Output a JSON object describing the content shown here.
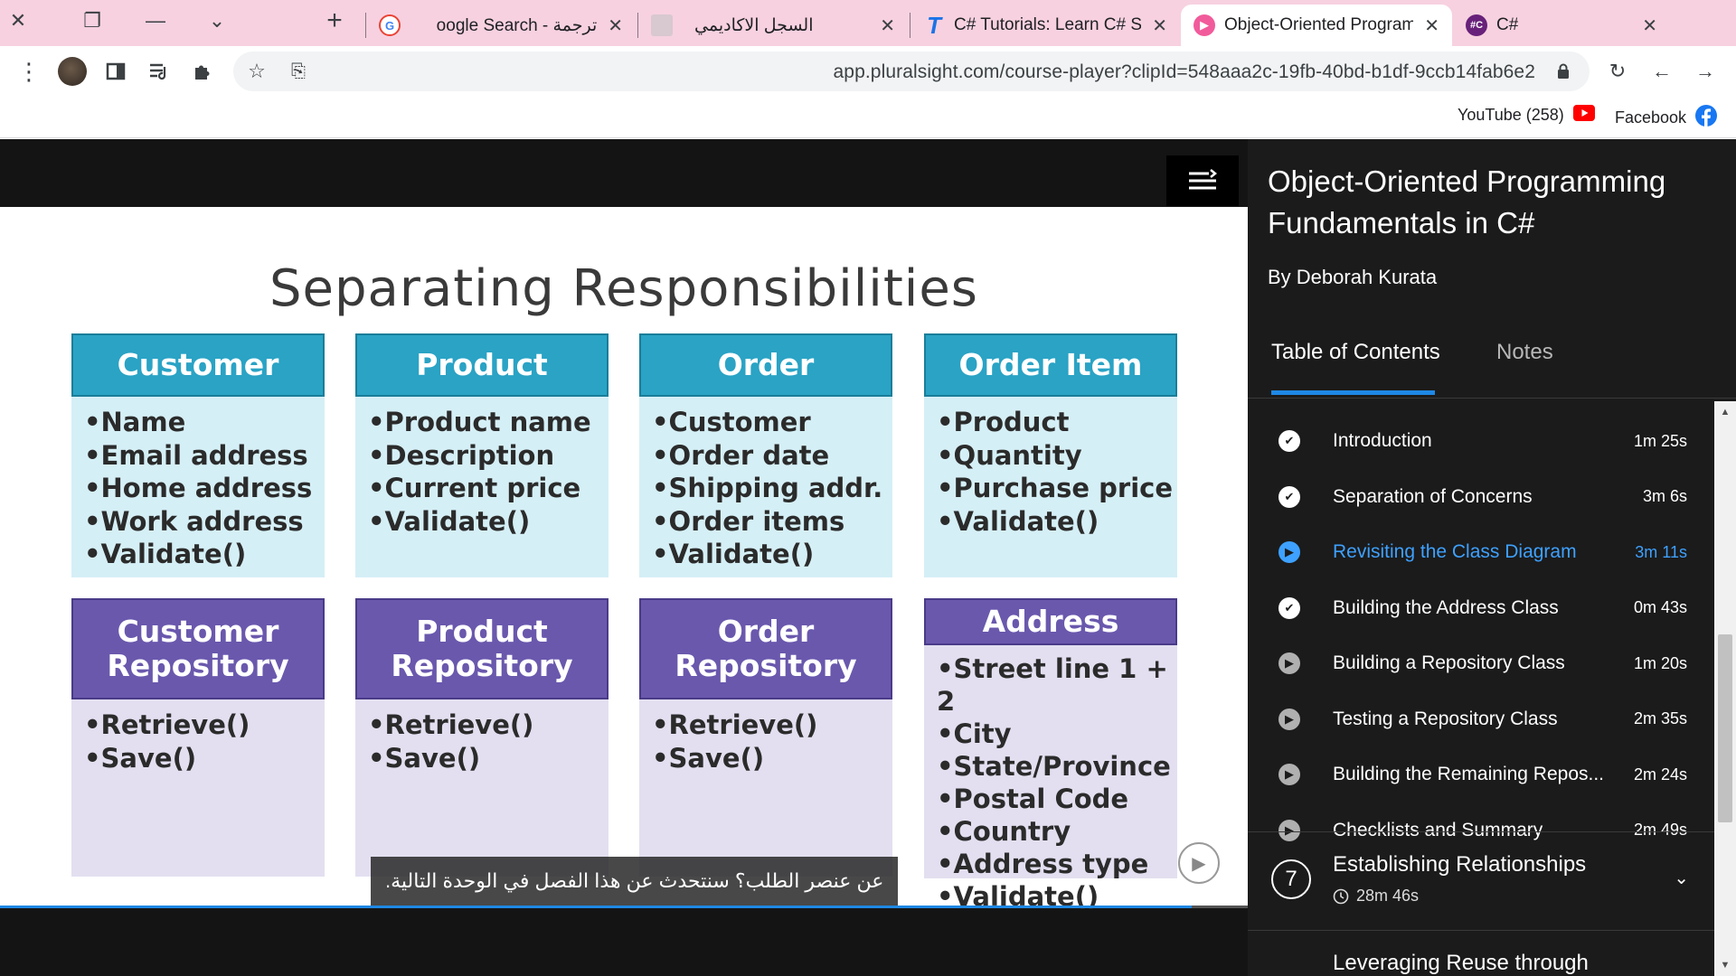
{
  "window": {
    "controls": [
      "✕",
      "❐",
      "—",
      "⌄"
    ],
    "new_tab": "+"
  },
  "tabs": [
    {
      "label": "ترجمة - Google Search",
      "icon": "google-icon",
      "active": false
    },
    {
      "label": "السجل الاكاديمي",
      "icon": "academic-record-icon",
      "active": false
    },
    {
      "label": "C# Tutorials: Learn C# Ste",
      "icon": "tutorials-icon",
      "active": false
    },
    {
      "label": "Object-Oriented Program",
      "icon": "pluralsight-icon",
      "active": true
    },
    {
      "label": "C#",
      "icon": "csharp-icon",
      "active": false
    }
  ],
  "address_bar": {
    "url": "app.pluralsight.com/course-player?clipId=548aaa2c-19fb-40bd-b1df-9ccb14fab6e2"
  },
  "bookmarks": [
    {
      "label": "YouTube (258)",
      "icon": "youtube-icon"
    },
    {
      "label": "Facebook",
      "icon": "facebook-icon"
    }
  ],
  "slide": {
    "title": "Separating Responsibilities",
    "cards": [
      {
        "title": "Customer",
        "items": [
          "•Name",
          "•Email address",
          "•Home address",
          "•Work address",
          "•Validate()"
        ]
      },
      {
        "title": "Product",
        "items": [
          "•Product name",
          "•Description",
          "•Current price",
          "•Validate()"
        ]
      },
      {
        "title": "Order",
        "items": [
          "•Customer",
          "•Order date",
          "•Shipping addr.",
          "•Order items",
          "•Validate()"
        ]
      },
      {
        "title": "Order Item",
        "items": [
          "•Product",
          "•Quantity",
          "•Purchase price",
          "•Validate()"
        ]
      },
      {
        "title": "Customer Repository",
        "items": [
          "•Retrieve()",
          "•Save()"
        ]
      },
      {
        "title": "Product Repository",
        "items": [
          "•Retrieve()",
          "•Save()"
        ]
      },
      {
        "title": "Order Repository",
        "items": [
          "•Retrieve()",
          "•Save()"
        ]
      },
      {
        "title": "Address",
        "items": [
          "•Street line 1 + 2",
          "•City",
          "•State/Province",
          "•Postal Code",
          "•Country",
          "•Address type",
          "•Validate()"
        ]
      }
    ]
  },
  "player": {
    "caption": "عن عنصر الطلب؟ سنتحدث عن هذا الفصل في الوحدة التالية.",
    "progress_fraction": 0.955,
    "colors": {
      "teal": "#2aa3c5",
      "purple": "#6a58ad",
      "accent": "#1e88e5"
    }
  },
  "sidebar": {
    "course_title": "Object-Oriented Programming Fundamentals in C#",
    "author": "By Deborah Kurata",
    "tabs": {
      "toc": "Table of Contents",
      "notes": "Notes"
    },
    "clips": [
      {
        "name": "Introduction",
        "duration": "1m 25s",
        "status": "done"
      },
      {
        "name": "Separation of Concerns",
        "duration": "3m 6s",
        "status": "done"
      },
      {
        "name": "Revisiting the Class Diagram",
        "duration": "3m 11s",
        "status": "current"
      },
      {
        "name": "Building the Address Class",
        "duration": "0m 43s",
        "status": "done"
      },
      {
        "name": "Building a Repository Class",
        "duration": "1m 20s",
        "status": "todo"
      },
      {
        "name": "Testing a Repository Class",
        "duration": "2m 35s",
        "status": "todo"
      },
      {
        "name": "Building the Remaining Repos...",
        "duration": "2m 24s",
        "status": "todo"
      },
      {
        "name": "Checklists and Summary",
        "duration": "2m 49s",
        "status": "todo"
      }
    ],
    "module7": {
      "number": "7",
      "title": "Establishing Relationships",
      "duration": "28m 46s"
    },
    "module8": {
      "title": "Leveraging Reuse through"
    }
  }
}
